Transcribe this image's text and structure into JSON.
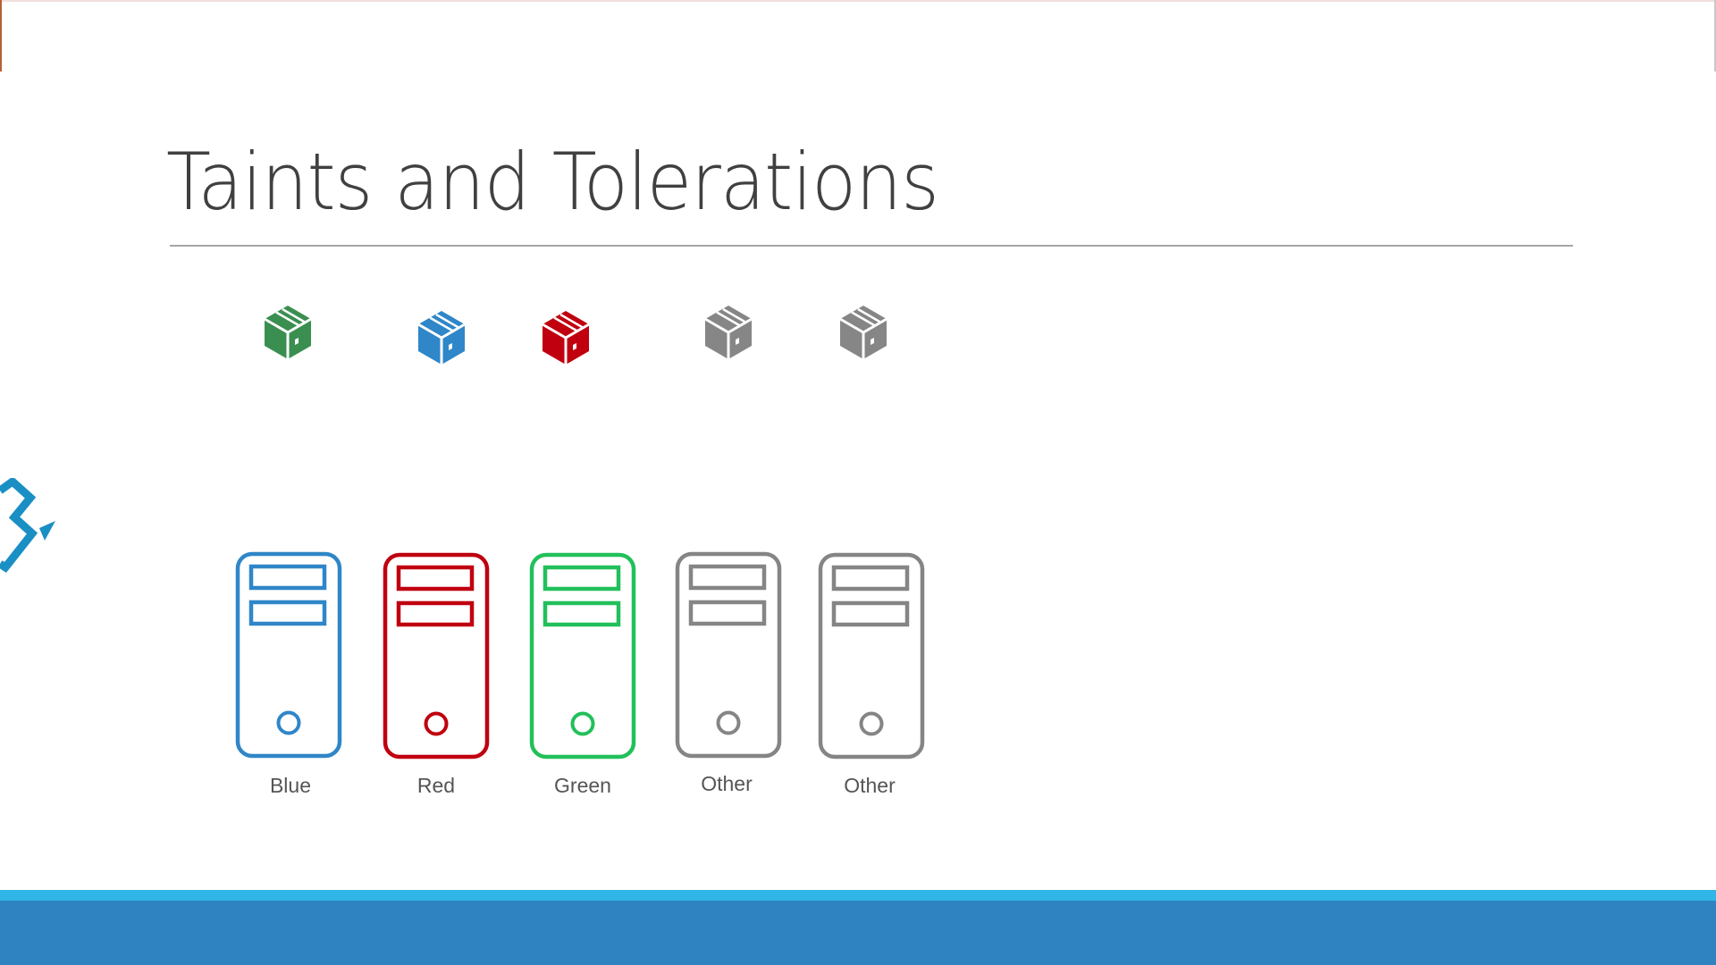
{
  "slide": {
    "title": "Taints and Tolerations",
    "colors": {
      "title": "#404040",
      "rule": "#a6a6a6",
      "band_light": "#2fb5e6",
      "band_dark": "#2e83c0",
      "logo": "#1a8fc4"
    }
  },
  "pods": [
    {
      "name": "pod-green",
      "color": "#3a8f50"
    },
    {
      "name": "pod-blue",
      "color": "#2f86c8"
    },
    {
      "name": "pod-red",
      "color": "#c0000f"
    },
    {
      "name": "pod-gray-1",
      "color": "#868686"
    },
    {
      "name": "pod-gray-2",
      "color": "#868686"
    }
  ],
  "nodes": [
    {
      "label": "Blue",
      "color": "#2f86c8"
    },
    {
      "label": "Red",
      "color": "#c0000f"
    },
    {
      "label": "Green",
      "color": "#22c05a"
    },
    {
      "label": "Other",
      "color": "#858585"
    },
    {
      "label": "Other",
      "color": "#858585"
    }
  ]
}
